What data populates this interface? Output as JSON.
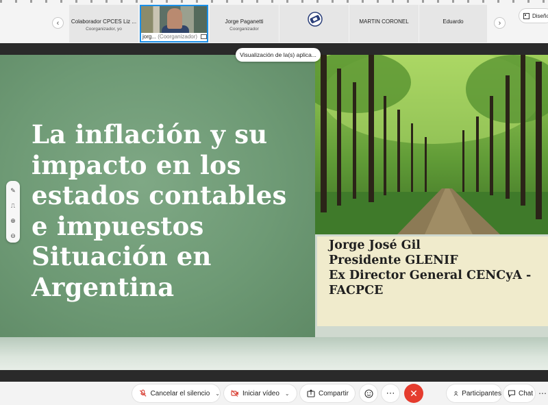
{
  "participants": {
    "tiles": [
      {
        "name": "Colaborador CPCES Liz ...",
        "role": "Coorganizador, yo"
      },
      {
        "name": "jorg...",
        "role": "(Coorganizador)"
      },
      {
        "name": "Jorge Paganetti",
        "role": "Coorganizador"
      },
      {
        "name": "",
        "role": ""
      },
      {
        "name": "MARTIN CORONEL",
        "role": ""
      },
      {
        "name": "Eduardo",
        "role": ""
      }
    ],
    "design_label": "Diseño"
  },
  "share_banner": "Visualización de la(s) aplica...",
  "slide": {
    "title_lines": [
      "La inflación y su",
      "impacto en los",
      "estados contables",
      "e impuestos",
      "Situación en",
      "Argentina"
    ],
    "presenter_lines": [
      "Jorge José Gil",
      "Presidente GLENIF",
      "Ex Director General CENCyA -",
      "FACPCE"
    ]
  },
  "controls": {
    "mute": "Cancelar el silencio",
    "video": "Iniciar vídeo",
    "share": "Compartir",
    "participants": "Participantes",
    "chat": "Chat"
  },
  "colors": {
    "accent": "#1a8fe8",
    "end_call": "#e53c2e",
    "slide_green": "#6e9a75",
    "info_box": "#f0ebcc"
  }
}
